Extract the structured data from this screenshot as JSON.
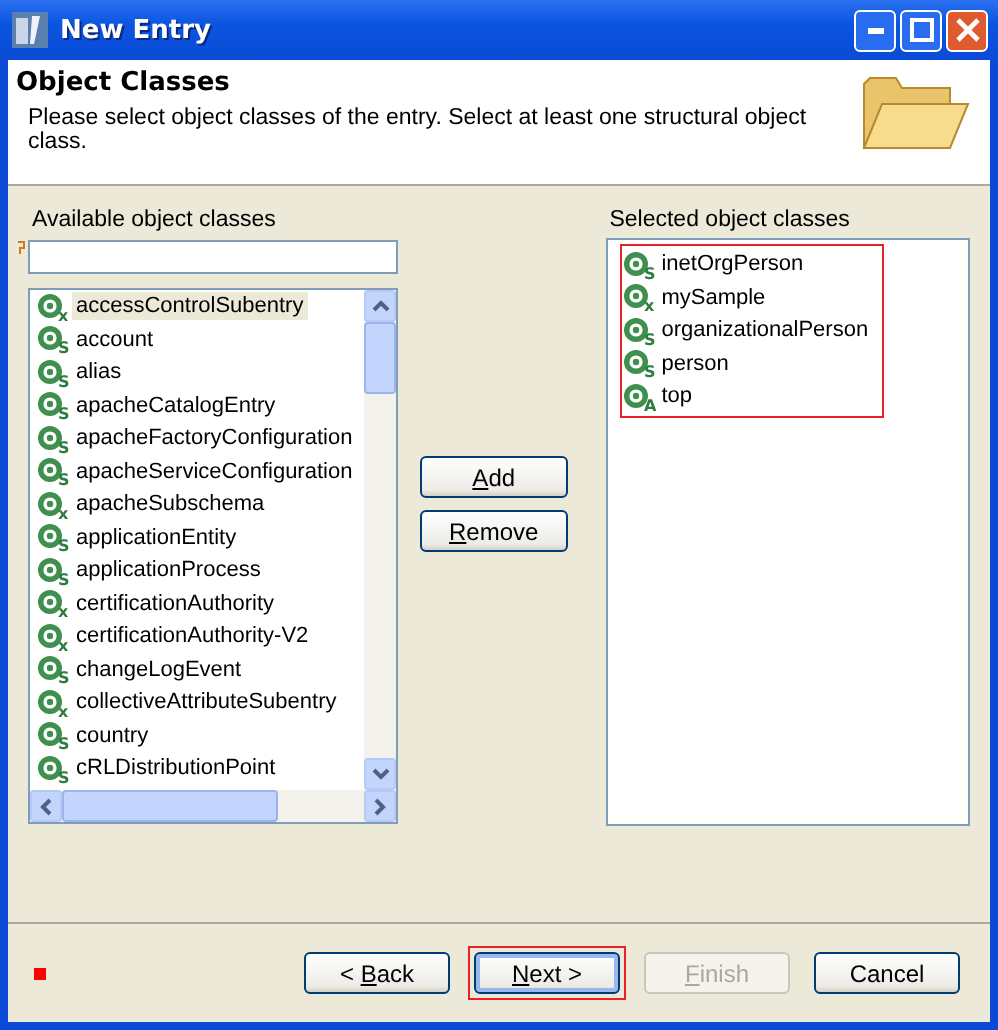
{
  "window": {
    "title": "New Entry"
  },
  "header": {
    "title": "Object Classes",
    "description": "Please select object classes of the entry. Select at least one structural object class."
  },
  "available": {
    "label": "Available object classes",
    "items": [
      {
        "name": "accessControlSubentry",
        "badge": "x",
        "selected": true
      },
      {
        "name": "account",
        "badge": "S",
        "selected": false
      },
      {
        "name": "alias",
        "badge": "S",
        "selected": false
      },
      {
        "name": "apacheCatalogEntry",
        "badge": "S",
        "selected": false
      },
      {
        "name": "apacheFactoryConfiguration",
        "badge": "S",
        "selected": false
      },
      {
        "name": "apacheServiceConfiguration",
        "badge": "S",
        "selected": false
      },
      {
        "name": "apacheSubschema",
        "badge": "x",
        "selected": false
      },
      {
        "name": "applicationEntity",
        "badge": "S",
        "selected": false
      },
      {
        "name": "applicationProcess",
        "badge": "S",
        "selected": false
      },
      {
        "name": "certificationAuthority",
        "badge": "x",
        "selected": false
      },
      {
        "name": "certificationAuthority-V2",
        "badge": "x",
        "selected": false
      },
      {
        "name": "changeLogEvent",
        "badge": "S",
        "selected": false
      },
      {
        "name": "collectiveAttributeSubentry",
        "badge": "x",
        "selected": false
      },
      {
        "name": "country",
        "badge": "S",
        "selected": false
      },
      {
        "name": "cRLDistributionPoint",
        "badge": "S",
        "selected": false
      }
    ]
  },
  "actions": [
    {
      "mnemonic": "A",
      "after": "dd"
    },
    {
      "mnemonic": "R",
      "after": "emove"
    }
  ],
  "selected": {
    "label": "Selected object classes",
    "highlighted": true,
    "items": [
      {
        "name": "inetOrgPerson",
        "badge": "S"
      },
      {
        "name": "mySample",
        "badge": "x"
      },
      {
        "name": "organizationalPerson",
        "badge": "S"
      },
      {
        "name": "person",
        "badge": "S"
      },
      {
        "name": "top",
        "badge": "A"
      }
    ]
  },
  "buttons": [
    {
      "before": "< ",
      "mnemonic": "B",
      "after": "ack",
      "disabled": false,
      "highlighted": false,
      "default": false
    },
    {
      "mnemonic": "N",
      "after": "ext >",
      "disabled": false,
      "highlighted": true,
      "default": true
    },
    {
      "mnemonic": "F",
      "after": "inish",
      "disabled": true,
      "highlighted": false,
      "default": false
    },
    {
      "label": "Cancel",
      "disabled": false,
      "highlighted": false,
      "default": false
    }
  ]
}
